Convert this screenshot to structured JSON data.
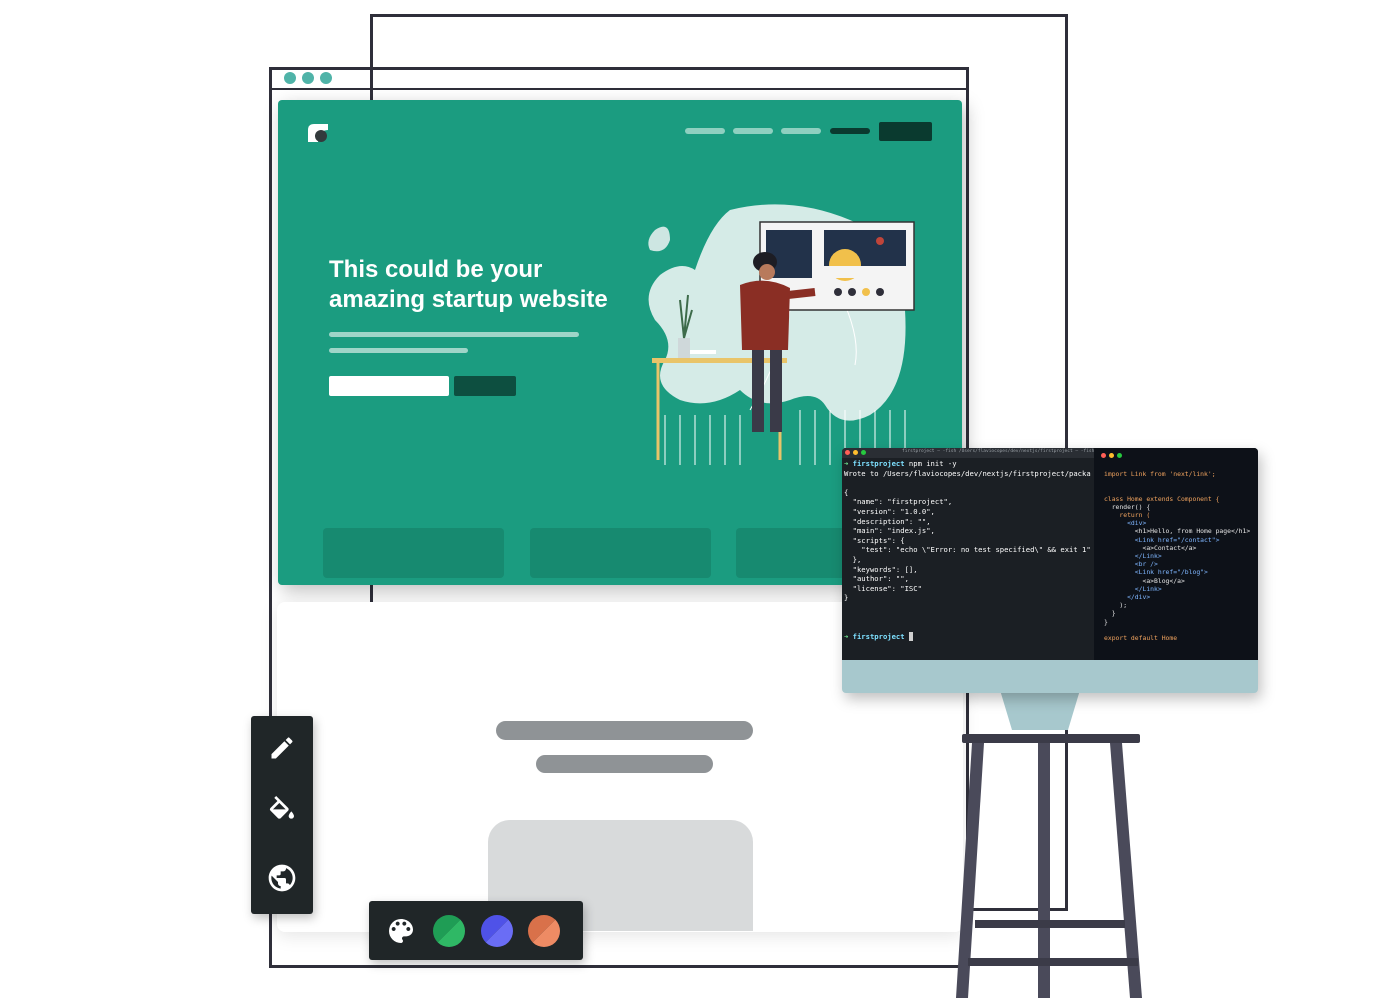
{
  "hero": {
    "headline_line1": "This could be your",
    "headline_line2": "amazing startup website"
  },
  "terminal": {
    "window_title": "firstproject — -fish  /Users/flaviocopes/dev/nextjs/firstproject — -fish — 71",
    "prompt_dir": "firstproject",
    "command": "npm init -y",
    "output_lines": [
      "Wrote to /Users/flaviocopes/dev/nextjs/firstproject/packa",
      "",
      "{",
      "  \"name\": \"firstproject\",",
      "  \"version\": \"1.0.0\",",
      "  \"description\": \"\",",
      "  \"main\": \"index.js\",",
      "  \"scripts\": {",
      "    \"test\": \"echo \\\"Error: no test specified\\\" && exit 1\"",
      "  },",
      "  \"keywords\": [],",
      "  \"author\": \"\",",
      "  \"license\": \"ISC\"",
      "}"
    ],
    "final_prompt_dir": "firstproject"
  },
  "editor": {
    "lines": [
      "import Link from 'next/link';",
      "",
      "",
      "class Home extends Component {",
      "  render() {",
      "    return (",
      "      <div>",
      "        <h1>Hello, from Home page</h1>",
      "        <Link href=\"/contact\">",
      "          <a>Contact</a>",
      "        </Link>",
      "        <br />",
      "        <Link href=\"/blog\">",
      "          <a>Blog</a>",
      "        </Link>",
      "      </div>",
      "    );",
      "  }",
      "}",
      "",
      "export default Home"
    ]
  },
  "toolbar": {
    "tools": [
      "pencil-icon",
      "paint-bucket-icon",
      "globe-icon"
    ]
  },
  "palette": {
    "icon": "palette-icon",
    "swatches": [
      {
        "name": "green",
        "color_a": "#1f9d55",
        "color_b": "#2fb865"
      },
      {
        "name": "indigo",
        "color_a": "#4f52e8",
        "color_b": "#6a6df5"
      },
      {
        "name": "orange",
        "color_a": "#d9714a",
        "color_b": "#ee8b64"
      }
    ]
  },
  "colors": {
    "hero_bg": "#1b9c80",
    "accent_dark": "#0a3a2f",
    "window_dot": "#4fb3a8"
  }
}
